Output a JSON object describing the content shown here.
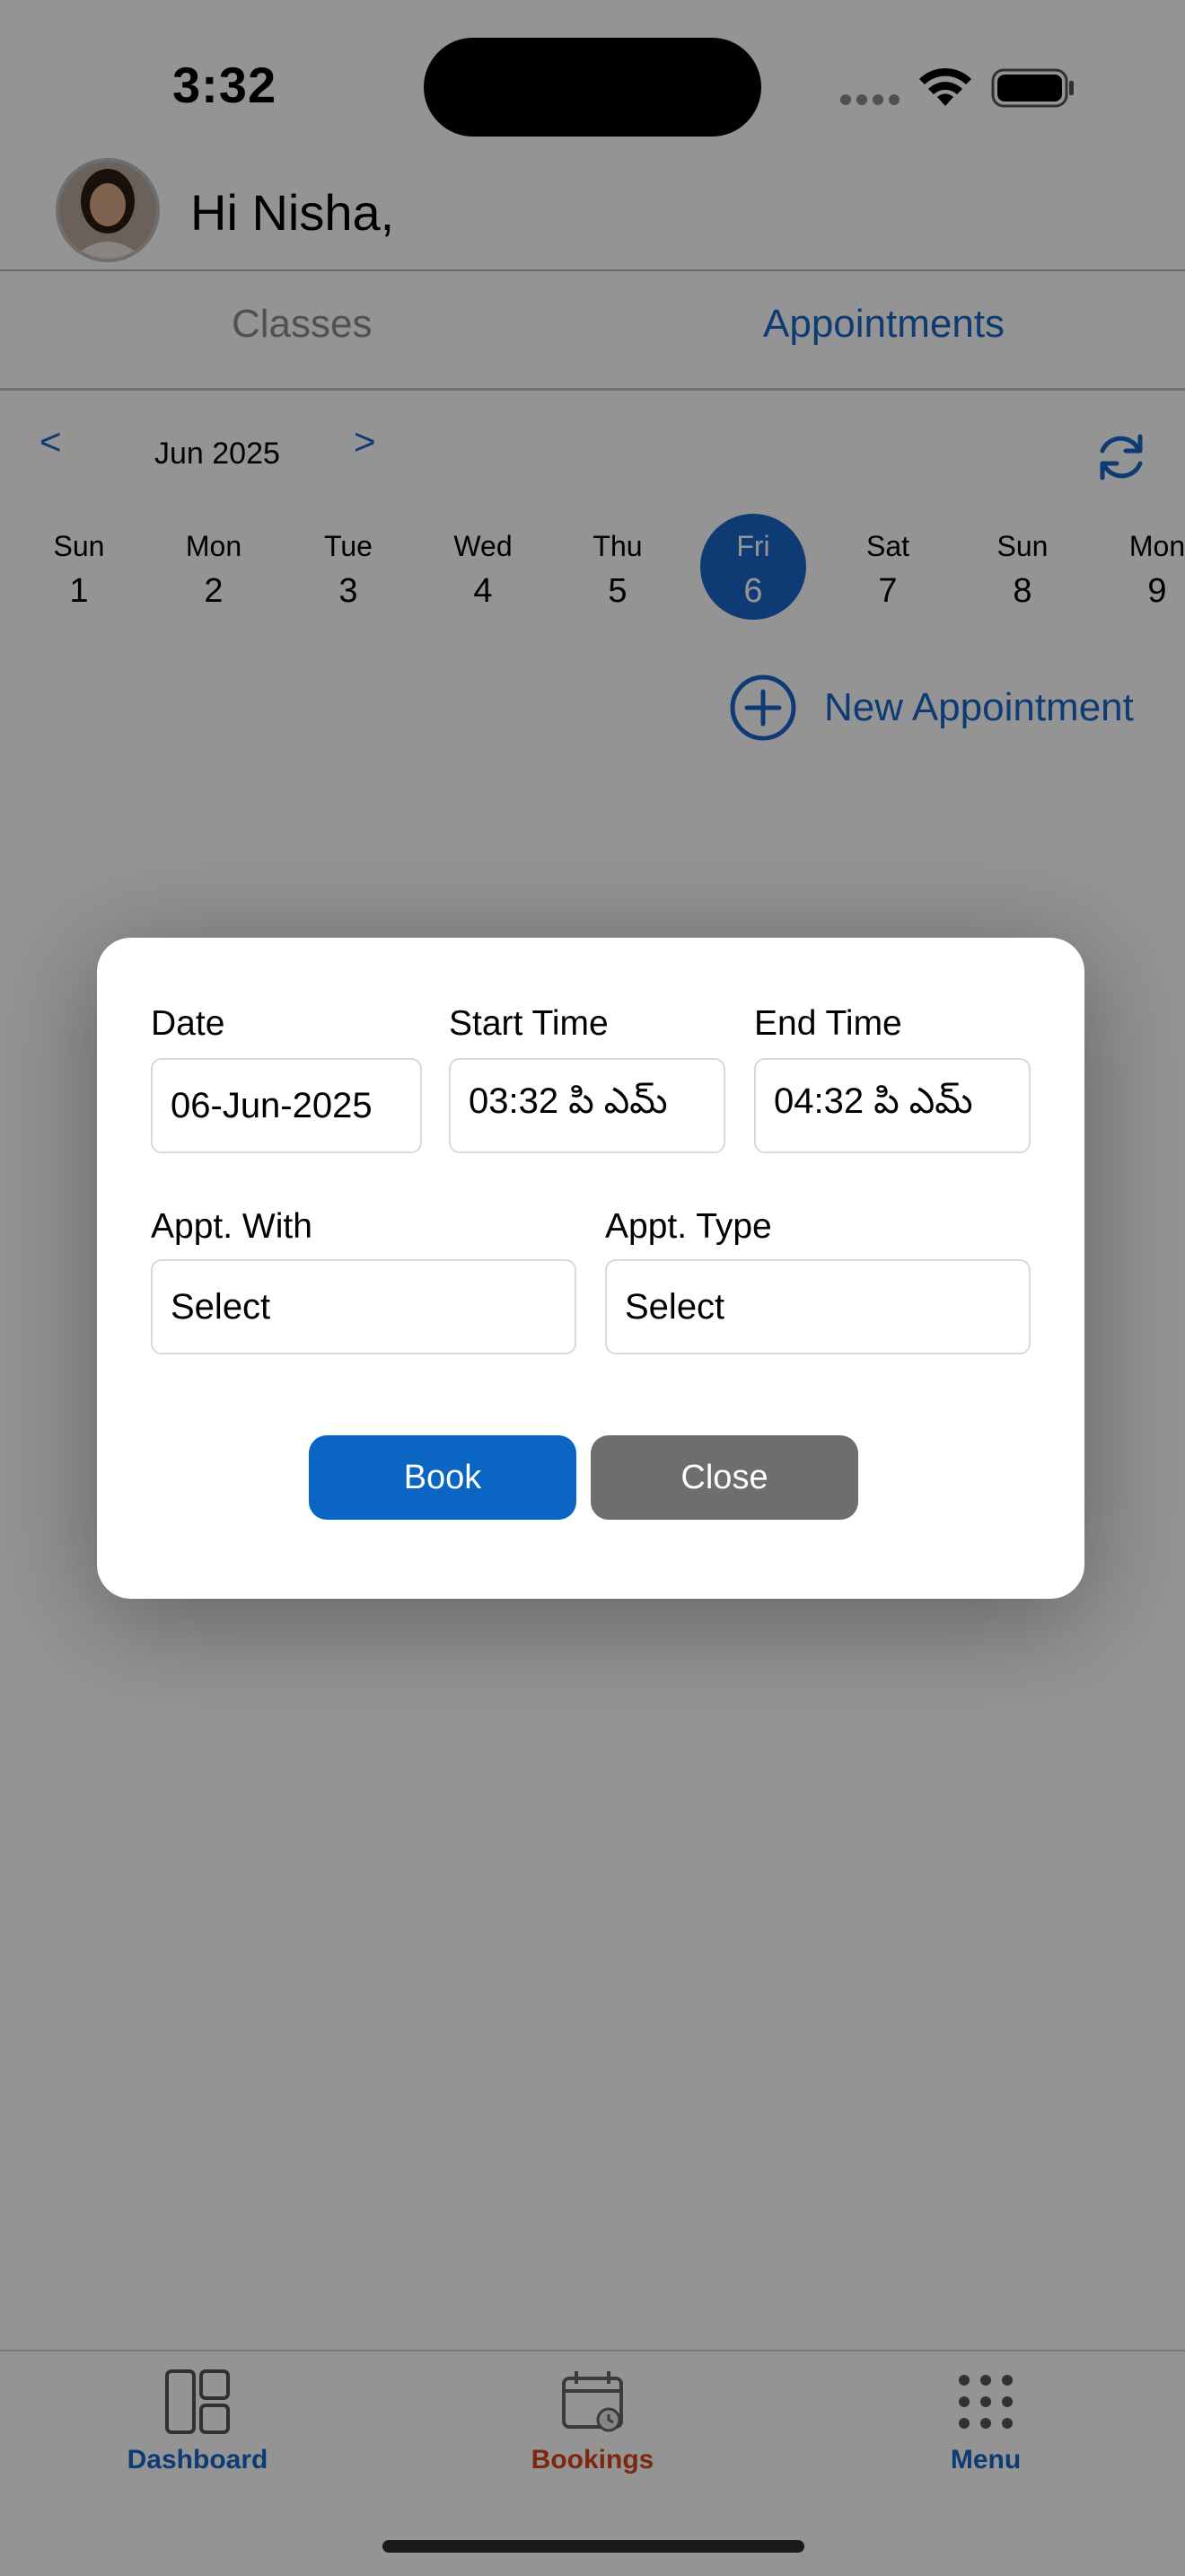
{
  "status_bar": {
    "time": "3:32",
    "icons": [
      "signal-dots-icon",
      "wifi-icon",
      "battery-icon"
    ]
  },
  "header": {
    "greeting": "Hi Nisha,",
    "avatar": "user-avatar"
  },
  "tabs": [
    {
      "label": "Classes",
      "active": false
    },
    {
      "label": "Appointments",
      "active": true
    }
  ],
  "calendar": {
    "prev": "<",
    "month": "Jun 2025",
    "next": ">",
    "days": [
      {
        "name": "Sun",
        "num": "1"
      },
      {
        "name": "Mon",
        "num": "2"
      },
      {
        "name": "Tue",
        "num": "3"
      },
      {
        "name": "Wed",
        "num": "4"
      },
      {
        "name": "Thu",
        "num": "5"
      },
      {
        "name": "Fri",
        "num": "6",
        "selected": true
      },
      {
        "name": "Sat",
        "num": "7"
      },
      {
        "name": "Sun",
        "num": "8"
      },
      {
        "name": "Mon",
        "num": "9"
      }
    ]
  },
  "new_appointment": {
    "label": "New Appointment"
  },
  "modal": {
    "date_label": "Date",
    "date_value": "06-Jun-2025",
    "start_label": "Start Time",
    "start_value": "03:32 పి ఎమ్",
    "end_label": "End Time",
    "end_value": "04:32 పి ఎమ్",
    "with_label": "Appt. With",
    "with_value": "Select",
    "type_label": "Appt. Type",
    "type_value": "Select",
    "book": "Book",
    "close": "Close"
  },
  "bottom_nav": [
    {
      "label": "Dashboard",
      "color": "#1b66c9",
      "icon": "dashboard-icon"
    },
    {
      "label": "Bookings",
      "color": "#d9441a",
      "icon": "calendar-icon"
    },
    {
      "label": "Menu",
      "color": "#1b66c9",
      "icon": "grid-dots-icon"
    }
  ],
  "colors": {
    "accent": "#1b66c9",
    "book_button": "#0a66c2",
    "close_button": "#6e6e6e",
    "active_nav": "#d9441a"
  }
}
